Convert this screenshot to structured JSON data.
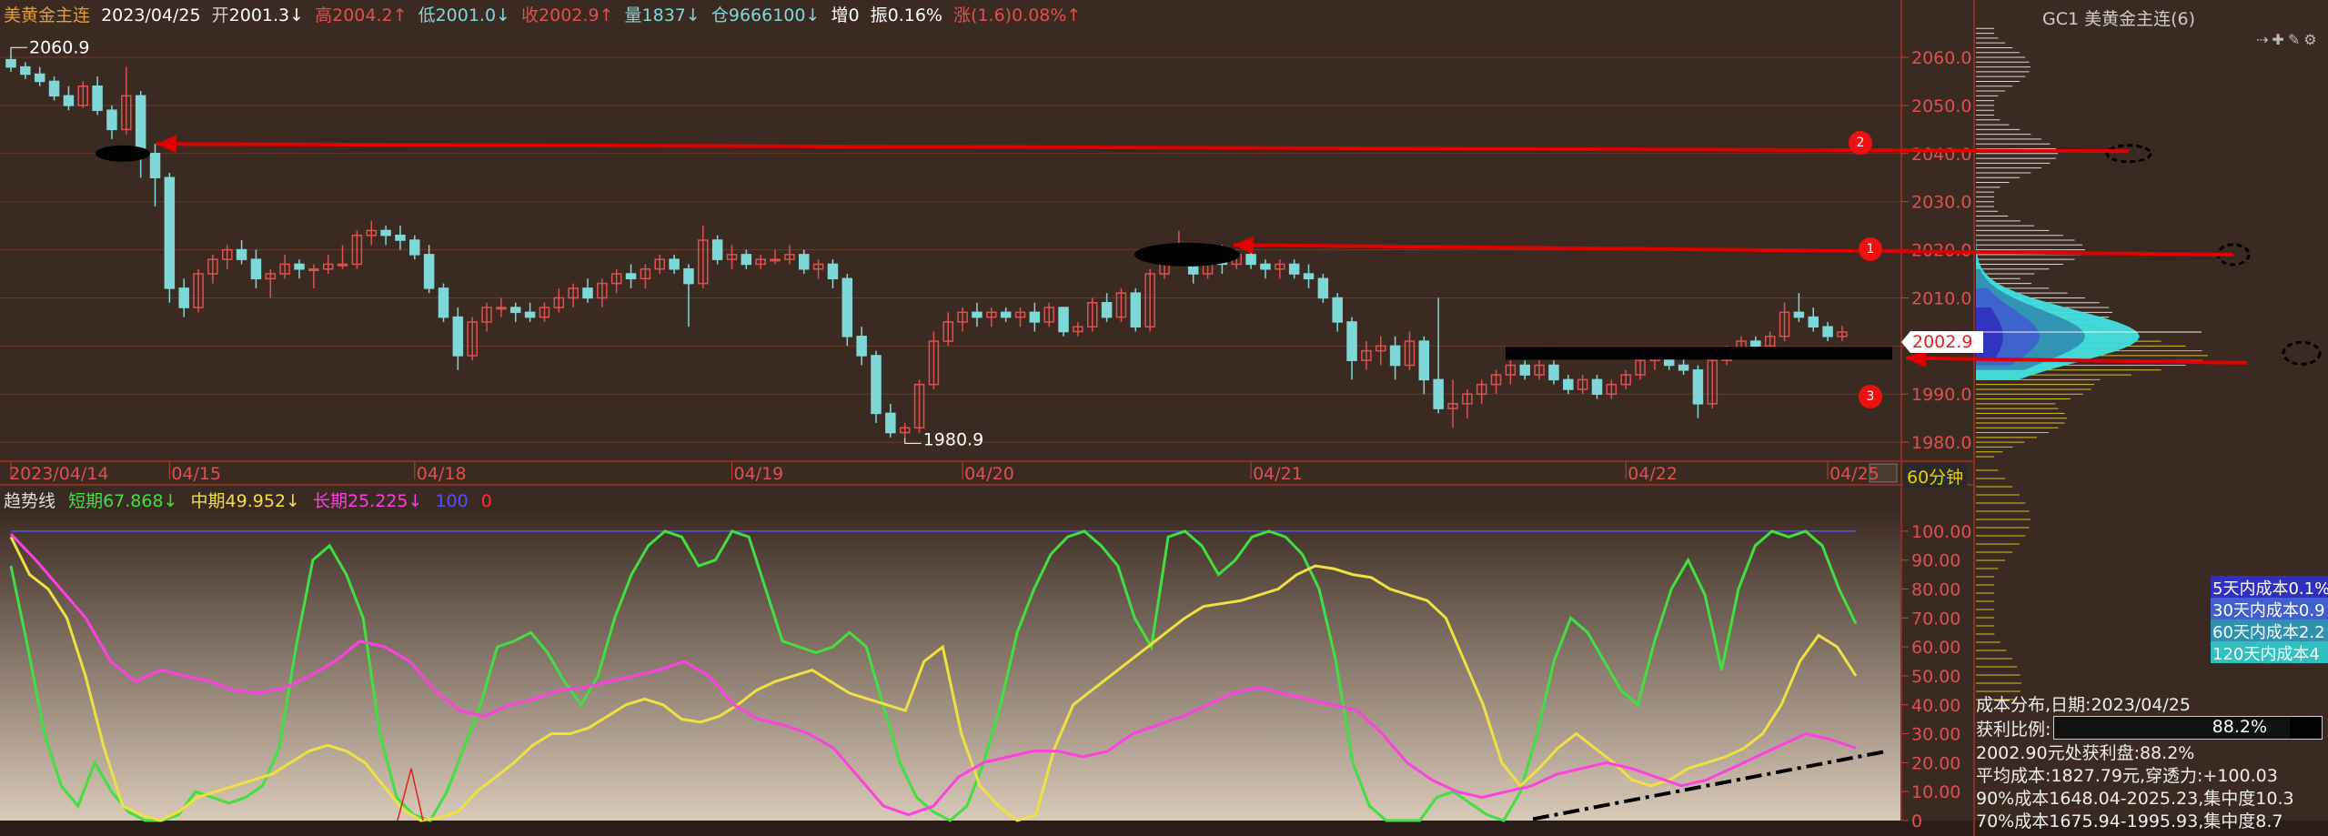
{
  "header": {
    "name": "美黄金主连",
    "date": "2023/04/25",
    "open_label": "开",
    "open": "2001.3↓",
    "high_label": "高",
    "high": "2004.2↑",
    "low_label": "低",
    "low": "2001.0↓",
    "close_label": "收",
    "close": "2002.9↑",
    "vol_label": "量",
    "vol": "1837↓",
    "oi_label": "仓",
    "oi": "9666100↓",
    "inc_label": "增",
    "inc": "0",
    "amp_label": "振",
    "amp": "0.16%",
    "chg": "涨(1.6)0.08%↑"
  },
  "panel_title": "GC1 美黄金主连(6)",
  "toolbar_icons": [
    "arrow-icon",
    "pin-icon",
    "pen-icon",
    "gear-icon"
  ],
  "period": "60分钟",
  "current_price_tag": "2002.9",
  "markers": {
    "high_mark": "2060.9",
    "low_mark": "1980.9"
  },
  "badges": [
    "2",
    "1",
    "3"
  ],
  "indicator": {
    "name": "趋势线",
    "short_label": "短期",
    "short_val": "67.868↓",
    "mid_label": "中期",
    "mid_val": "49.952↓",
    "long_label": "长期",
    "long_val": "25.225↓",
    "level": "100",
    "zero": "0"
  },
  "cost_legend": [
    "5天内成本0.1%",
    "30天内成本0.9",
    "60天内成本2.2",
    "120天内成本4"
  ],
  "cost_info": {
    "line1": "成本分布,日期:2023/04/25",
    "ratio_label": "获利比例:",
    "ratio": "88.2%",
    "line3": "2002.90元处获利盘:88.2%",
    "line4": "平均成本:1827.79元,穿透力:+100.03",
    "line5": "90%成本1648.04-2025.23,集中度10.3",
    "line6": "70%成本1675.94-1995.93,集中度8.7"
  },
  "colors": {
    "up": "#e05050",
    "down": "#7fd8d8",
    "short": "#40e040",
    "mid": "#f0e040",
    "long": "#ff40e0",
    "arrow": "#e00000"
  },
  "chart_data": [
    {
      "type": "candlestick",
      "ylim": [
        1977,
        2067
      ],
      "yticks": [
        "2060.0",
        "2050.0",
        "2040.0",
        "2030.0",
        "2020.0",
        "2010.0",
        "2000.0",
        "1990.0",
        "1980.0"
      ],
      "xticks": [
        "2023/04/14",
        "04/15",
        "04/18",
        "04/19",
        "04/20",
        "04/21",
        "04/22",
        "04/25"
      ],
      "ohlc": [
        [
          2059.5,
          2060.9,
          2057.0,
          2058.0
        ],
        [
          2058.0,
          2059.0,
          2055.5,
          2056.5
        ],
        [
          2056.5,
          2058.0,
          2054.0,
          2055.0
        ],
        [
          2055.0,
          2056.0,
          2051.0,
          2052.0
        ],
        [
          2052.0,
          2054.0,
          2049.0,
          2050.0
        ],
        [
          2050.0,
          2055.0,
          2049.5,
          2054.0
        ],
        [
          2054.0,
          2056.0,
          2048.0,
          2049.0
        ],
        [
          2049.0,
          2050.0,
          2043.0,
          2045.0
        ],
        [
          2045.0,
          2058.0,
          2044.0,
          2052.0
        ],
        [
          2052.0,
          2053.0,
          2035.0,
          2040.0
        ],
        [
          2040.0,
          2042.0,
          2029.0,
          2035.0
        ],
        [
          2035.0,
          2036.0,
          2009.0,
          2012.0
        ],
        [
          2012.0,
          2014.0,
          2006.0,
          2008.0
        ],
        [
          2008.0,
          2016.0,
          2007.0,
          2015.0
        ],
        [
          2015.0,
          2019.0,
          2013.0,
          2018.0
        ],
        [
          2018.0,
          2021.0,
          2016.0,
          2020.0
        ],
        [
          2020.0,
          2022.0,
          2017.0,
          2018.0
        ],
        [
          2018.0,
          2020.0,
          2012.0,
          2014.0
        ],
        [
          2014.0,
          2016.0,
          2010.0,
          2015.0
        ],
        [
          2015.0,
          2019.0,
          2014.0,
          2017.0
        ],
        [
          2017.0,
          2018.0,
          2014.0,
          2016.0
        ],
        [
          2016.0,
          2017.0,
          2012.0,
          2016.0
        ],
        [
          2016.0,
          2019.0,
          2015.0,
          2017.0
        ],
        [
          2017.0,
          2021.0,
          2016.0,
          2017.0
        ],
        [
          2017.0,
          2024.0,
          2016.0,
          2023.0
        ],
        [
          2023.0,
          2026.0,
          2021.0,
          2024.0
        ],
        [
          2024.0,
          2025.0,
          2021.0,
          2023.0
        ],
        [
          2023.0,
          2025.0,
          2020.0,
          2022.0
        ],
        [
          2022.0,
          2023.0,
          2018.0,
          2019.0
        ],
        [
          2019.0,
          2021.0,
          2011.0,
          2012.0
        ],
        [
          2012.0,
          2013.0,
          2005.0,
          2006.0
        ],
        [
          2006.0,
          2008.0,
          1995.0,
          1998.0
        ],
        [
          1998.0,
          2006.0,
          1997.0,
          2005.0
        ],
        [
          2005.0,
          2009.0,
          2003.0,
          2008.0
        ],
        [
          2008.0,
          2010.0,
          2006.0,
          2008.0
        ],
        [
          2008.0,
          2009.0,
          2005.0,
          2007.0
        ],
        [
          2007.0,
          2009.0,
          2005.0,
          2006.0
        ],
        [
          2006.0,
          2009.0,
          2005.0,
          2008.0
        ],
        [
          2008.0,
          2012.0,
          2007.0,
          2010.0
        ],
        [
          2010.0,
          2013.0,
          2008.0,
          2012.0
        ],
        [
          2012.0,
          2014.0,
          2009.0,
          2010.0
        ],
        [
          2010.0,
          2014.0,
          2008.0,
          2013.0
        ],
        [
          2013.0,
          2016.0,
          2011.0,
          2015.0
        ],
        [
          2015.0,
          2017.0,
          2012.0,
          2014.0
        ],
        [
          2014.0,
          2017.0,
          2012.0,
          2016.0
        ],
        [
          2016.0,
          2019.0,
          2015.0,
          2018.0
        ],
        [
          2018.0,
          2019.0,
          2015.0,
          2016.0
        ],
        [
          2016.0,
          2017.0,
          2004.0,
          2013.0
        ],
        [
          2013.0,
          2025.0,
          2012.0,
          2022.0
        ],
        [
          2022.0,
          2023.0,
          2017.0,
          2018.0
        ],
        [
          2018.0,
          2021.0,
          2016.0,
          2019.0
        ],
        [
          2019.0,
          2020.0,
          2016.0,
          2017.0
        ],
        [
          2017.0,
          2019.0,
          2016.0,
          2018.0
        ],
        [
          2018.0,
          2020.0,
          2017.0,
          2018.0
        ],
        [
          2018.0,
          2021.0,
          2017.0,
          2019.0
        ],
        [
          2019.0,
          2020.0,
          2015.0,
          2016.0
        ],
        [
          2016.0,
          2018.0,
          2014.0,
          2017.0
        ],
        [
          2017.0,
          2018.0,
          2012.0,
          2014.0
        ],
        [
          2014.0,
          2015.0,
          2000.0,
          2002.0
        ],
        [
          2002.0,
          2004.0,
          1996.0,
          1998.0
        ],
        [
          1998.0,
          1999.0,
          1984.0,
          1986.0
        ],
        [
          1986.0,
          1988.0,
          1981.0,
          1982.0
        ],
        [
          1982.0,
          1984.0,
          1980.9,
          1983.0
        ],
        [
          1983.0,
          1993.0,
          1982.0,
          1992.0
        ],
        [
          1992.0,
          2003.0,
          1991.0,
          2001.0
        ],
        [
          2001.0,
          2007.0,
          2000.0,
          2005.0
        ],
        [
          2005.0,
          2008.0,
          2003.0,
          2007.0
        ],
        [
          2007.0,
          2009.0,
          2004.0,
          2006.0
        ],
        [
          2006.0,
          2008.0,
          2004.0,
          2007.0
        ],
        [
          2007.0,
          2008.0,
          2005.0,
          2006.0
        ],
        [
          2006.0,
          2008.0,
          2004.0,
          2007.0
        ],
        [
          2007.0,
          2009.0,
          2003.0,
          2005.0
        ],
        [
          2005.0,
          2009.0,
          2004.0,
          2008.0
        ],
        [
          2008.0,
          2008.0,
          2002.0,
          2003.0
        ],
        [
          2003.0,
          2005.0,
          2002.0,
          2004.0
        ],
        [
          2004.0,
          2010.0,
          2003.0,
          2009.0
        ],
        [
          2009.0,
          2011.0,
          2005.0,
          2006.0
        ],
        [
          2006.0,
          2012.0,
          2005.0,
          2011.0
        ],
        [
          2011.0,
          2012.0,
          2003.0,
          2004.0
        ],
        [
          2004.0,
          2016.0,
          2003.0,
          2015.0
        ],
        [
          2015.0,
          2020.0,
          2014.0,
          2018.0
        ],
        [
          2018.0,
          2024.0,
          2017.0,
          2019.0
        ],
        [
          2019.0,
          2020.0,
          2013.0,
          2015.0
        ],
        [
          2015.0,
          2021.0,
          2014.0,
          2020.0
        ],
        [
          2020.0,
          2021.0,
          2015.0,
          2017.0
        ],
        [
          2017.0,
          2020.0,
          2016.0,
          2019.0
        ],
        [
          2019.0,
          2020.0,
          2016.0,
          2017.0
        ],
        [
          2017.0,
          2018.0,
          2014.0,
          2016.0
        ],
        [
          2016.0,
          2018.0,
          2014.0,
          2017.0
        ],
        [
          2017.0,
          2018.0,
          2014.0,
          2015.0
        ],
        [
          2015.0,
          2017.0,
          2012.0,
          2014.0
        ],
        [
          2014.0,
          2015.0,
          2009.0,
          2010.0
        ],
        [
          2010.0,
          2011.0,
          2003.0,
          2005.0
        ],
        [
          2005.0,
          2006.0,
          1993.0,
          1997.0
        ],
        [
          1997.0,
          2001.0,
          1995.0,
          1999.0
        ],
        [
          1999.0,
          2002.0,
          1996.0,
          2000.0
        ],
        [
          2000.0,
          2002.0,
          1993.0,
          1996.0
        ],
        [
          1996.0,
          2003.0,
          1995.0,
          2001.0
        ],
        [
          2001.0,
          2002.0,
          1990.0,
          1993.0
        ],
        [
          1993.0,
          2010.0,
          1986.0,
          1987.0
        ],
        [
          1987.0,
          1993.0,
          1983.0,
          1988.0
        ],
        [
          1988.0,
          1991.0,
          1985.0,
          1990.0
        ],
        [
          1990.0,
          1993.0,
          1988.0,
          1992.0
        ],
        [
          1992.0,
          1995.0,
          1990.0,
          1994.0
        ],
        [
          1994.0,
          1997.0,
          1992.0,
          1996.0
        ],
        [
          1996.0,
          1997.0,
          1993.0,
          1994.0
        ],
        [
          1994.0,
          1997.0,
          1993.0,
          1996.0
        ],
        [
          1996.0,
          1997.0,
          1992.0,
          1993.0
        ],
        [
          1993.0,
          1994.0,
          1990.0,
          1991.0
        ],
        [
          1991.0,
          1994.0,
          1990.0,
          1993.0
        ],
        [
          1993.0,
          1994.0,
          1989.0,
          1990.0
        ],
        [
          1990.0,
          1993.0,
          1989.0,
          1992.0
        ],
        [
          1992.0,
          1995.0,
          1991.0,
          1994.0
        ],
        [
          1994.0,
          1998.0,
          1993.0,
          1997.0
        ],
        [
          1997.0,
          1999.0,
          1995.0,
          1998.0
        ],
        [
          1998.0,
          1999.0,
          1995.0,
          1996.0
        ],
        [
          1996.0,
          1998.0,
          1994.0,
          1995.0
        ],
        [
          1995.0,
          1996.0,
          1985.0,
          1988.0
        ],
        [
          1988.0,
          1998.0,
          1987.0,
          1997.0
        ],
        [
          1997.0,
          2000.0,
          1996.0,
          1999.0
        ],
        [
          1999.0,
          2002.0,
          1998.0,
          2001.0
        ],
        [
          2001.0,
          2002.0,
          1999.0,
          2000.0
        ],
        [
          2000.0,
          2003.0,
          1999.0,
          2002.0
        ],
        [
          2002.0,
          2009.0,
          2001.0,
          2007.0
        ],
        [
          2007.0,
          2011.0,
          2005.0,
          2006.0
        ],
        [
          2006.0,
          2008.0,
          2003.0,
          2004.0
        ],
        [
          2004.0,
          2005.0,
          2001.0,
          2002.0
        ],
        [
          2002.0,
          2004.2,
          2001.0,
          2002.9
        ]
      ]
    },
    {
      "type": "line",
      "ylim": [
        0,
        105
      ],
      "yticks": [
        "100.00",
        "90.00",
        "80.00",
        "70.00",
        "60.00",
        "50.00",
        "40.00",
        "30.00",
        "20.00",
        "10.00",
        "0"
      ],
      "series": [
        {
          "name": "短期",
          "values": [
            88,
            60,
            30,
            12,
            5,
            20,
            10,
            3,
            0,
            0,
            2,
            10,
            8,
            6,
            8,
            12,
            25,
            60,
            90,
            95,
            85,
            70,
            30,
            8,
            2,
            0,
            10,
            25,
            40,
            60,
            62,
            65,
            58,
            48,
            40,
            50,
            70,
            85,
            95,
            100,
            98,
            88,
            90,
            100,
            98,
            80,
            62,
            60,
            58,
            60,
            65,
            60,
            40,
            20,
            8,
            3,
            0,
            5,
            20,
            40,
            65,
            80,
            92,
            98,
            100,
            95,
            88,
            70,
            60,
            98,
            100,
            95,
            85,
            90,
            98,
            100,
            98,
            92,
            80,
            55,
            20,
            5,
            0,
            0,
            0,
            8,
            10,
            6,
            2,
            0,
            10,
            30,
            55,
            70,
            65,
            55,
            45,
            40,
            62,
            80,
            90,
            78,
            52,
            80,
            95,
            100,
            98,
            100,
            95,
            80,
            68
          ]
        },
        {
          "name": "中期",
          "values": [
            98,
            85,
            80,
            70,
            50,
            25,
            5,
            2,
            0,
            3,
            8,
            10,
            12,
            14,
            16,
            20,
            24,
            26,
            24,
            20,
            12,
            4,
            0,
            1,
            3,
            10,
            15,
            20,
            26,
            30,
            30,
            32,
            36,
            40,
            42,
            40,
            35,
            34,
            36,
            40,
            45,
            48,
            50,
            52,
            48,
            44,
            42,
            40,
            38,
            55,
            60,
            30,
            12,
            5,
            0,
            2,
            25,
            40,
            45,
            50,
            55,
            60,
            65,
            70,
            74,
            75,
            76,
            78,
            80,
            85,
            88,
            87,
            85,
            84,
            80,
            78,
            76,
            70,
            55,
            40,
            20,
            12,
            18,
            25,
            30,
            25,
            20,
            14,
            12,
            14,
            18,
            20,
            22,
            25,
            30,
            40,
            55,
            64,
            60,
            50
          ]
        },
        {
          "name": "长期",
          "values": [
            99,
            90,
            80,
            70,
            55,
            48,
            52,
            50,
            48,
            45,
            44,
            46,
            50,
            55,
            62,
            60,
            55,
            45,
            38,
            36,
            40,
            42,
            45,
            46,
            48,
            50,
            52,
            55,
            50,
            40,
            35,
            33,
            30,
            25,
            15,
            5,
            2,
            5,
            15,
            20,
            22,
            24,
            24,
            22,
            24,
            30,
            33,
            36,
            40,
            44,
            46,
            44,
            42,
            40,
            38,
            30,
            20,
            14,
            10,
            8,
            10,
            12,
            16,
            18,
            20,
            18,
            15,
            12,
            14,
            18,
            22,
            26,
            30,
            28,
            25
          ]
        }
      ]
    }
  ]
}
